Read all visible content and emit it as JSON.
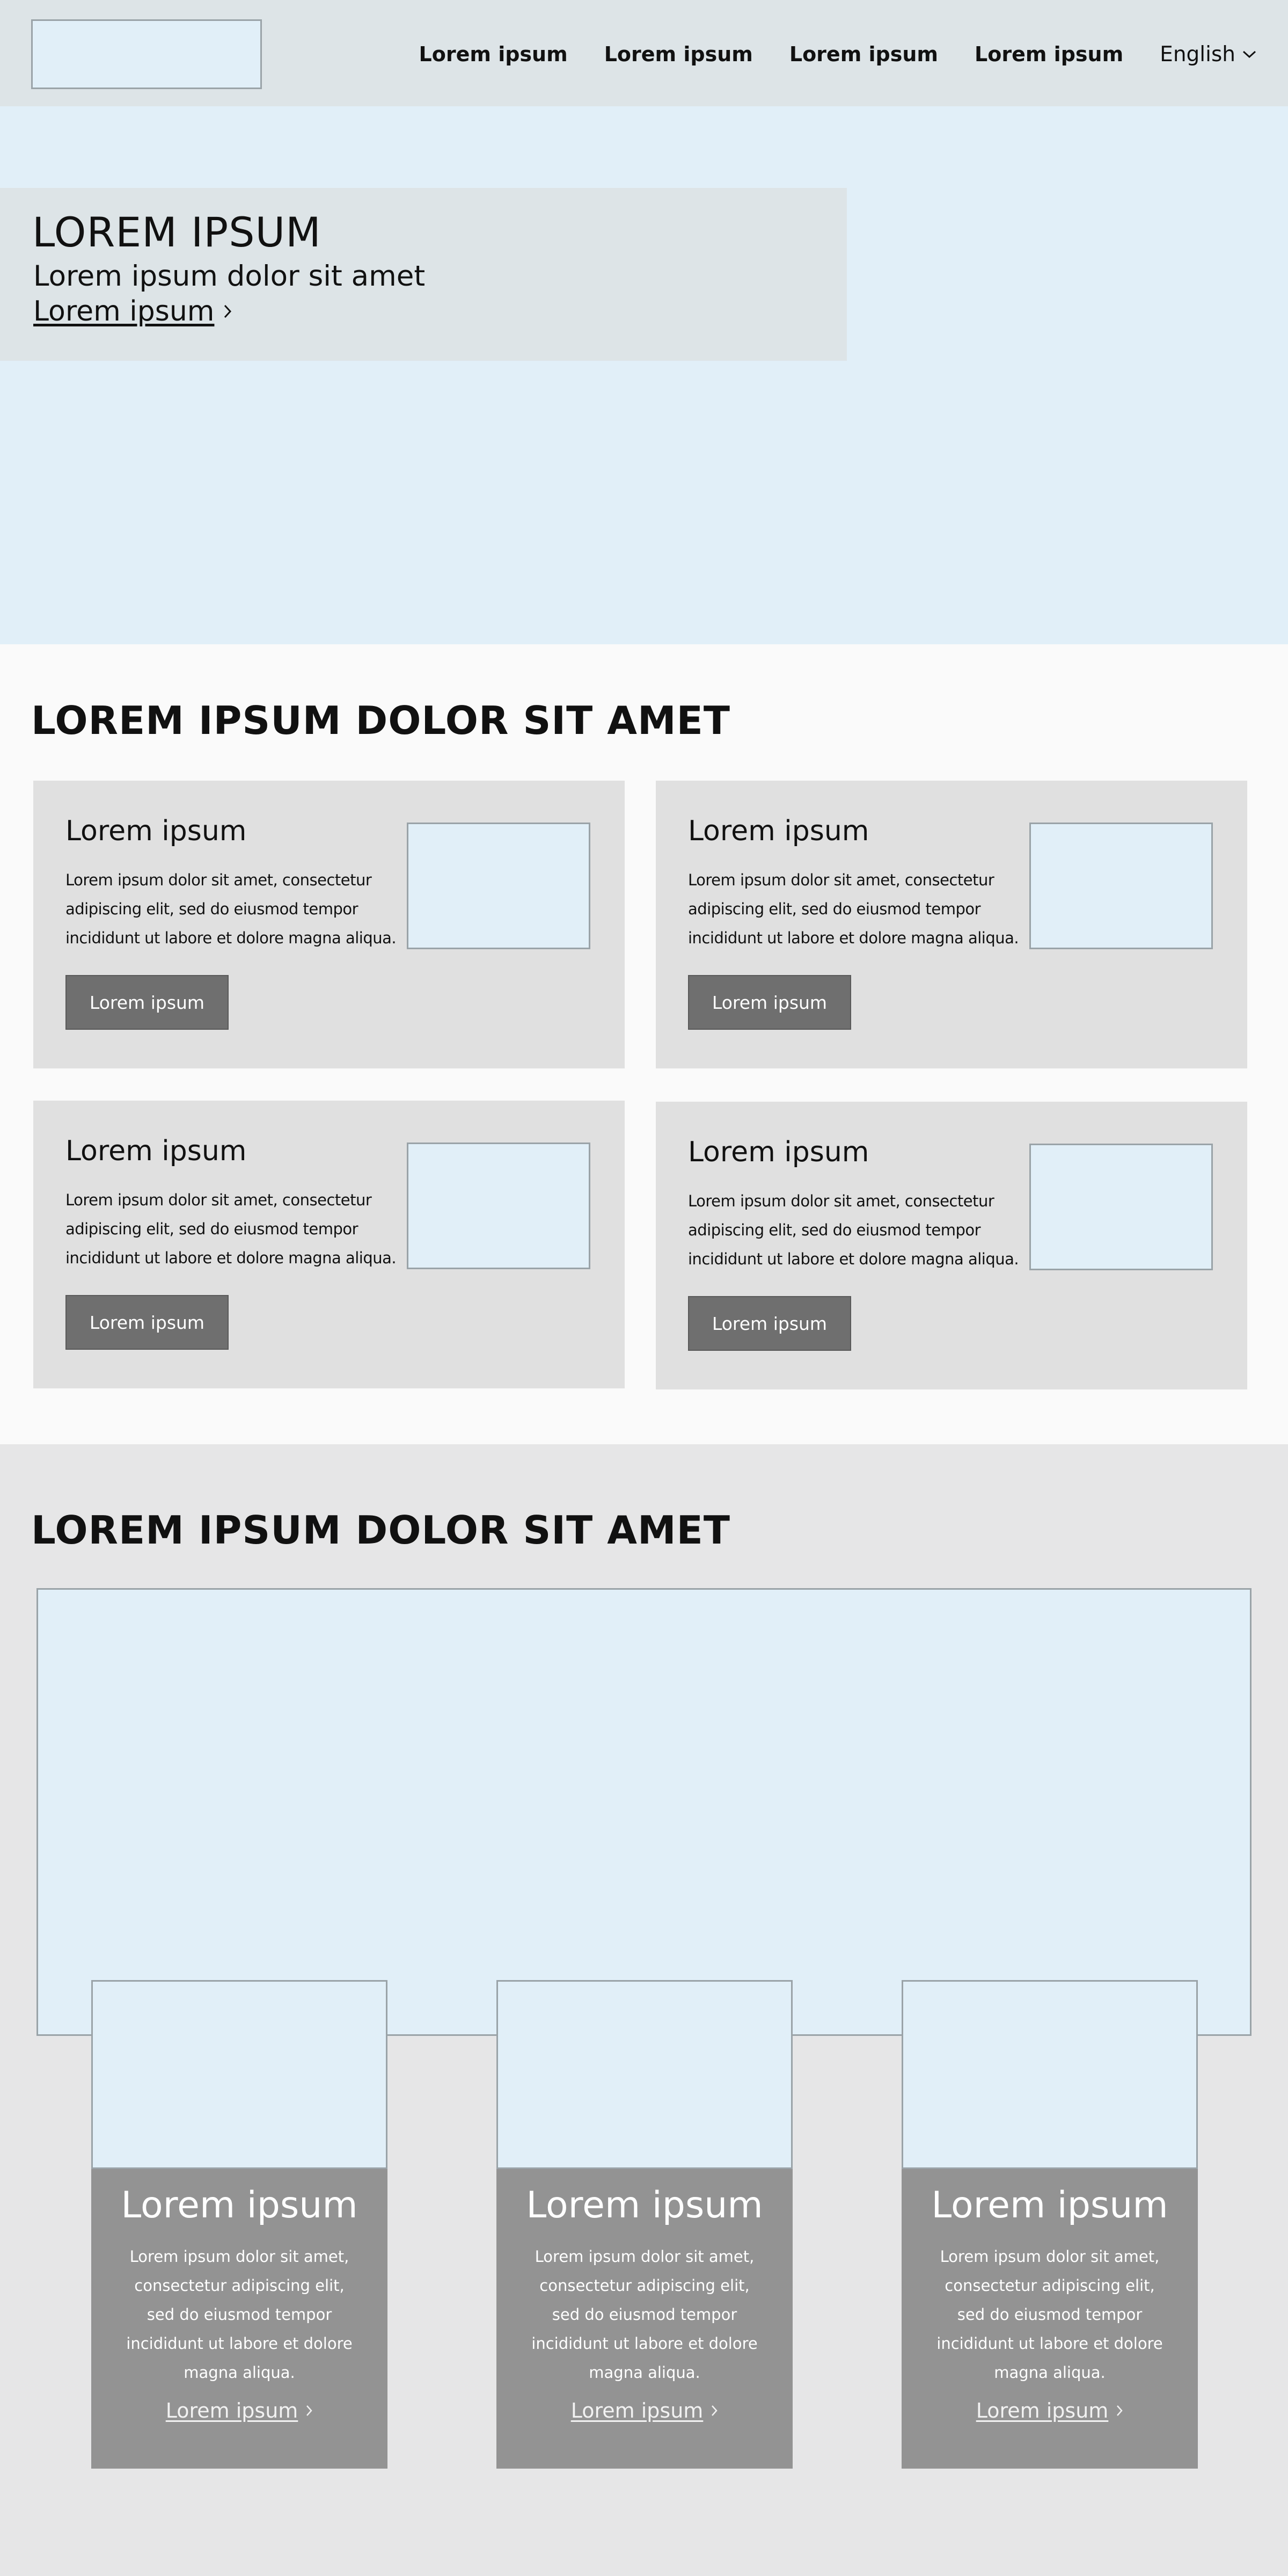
{
  "header": {
    "nav": [
      "Lorem ipsum",
      "Lorem ipsum",
      "Lorem ipsum",
      "Lorem ipsum"
    ],
    "language": "English",
    "language_icon": "chevron-down-icon"
  },
  "hero": {
    "title": "LOREM IPSUM",
    "subtitle": "Lorem ipsum dolor sit amet",
    "link": "Lorem ipsum",
    "link_icon": "chevron-right-icon"
  },
  "section1": {
    "title": "LOREM IPSUM DOLOR SIT AMET",
    "cards": [
      {
        "title": "Lorem ipsum",
        "text": "Lorem ipsum dolor sit amet, consectetur adipiscing elit, sed do eiusmod tempor incididunt ut labore et dolore magna aliqua.",
        "button": "Lorem ipsum"
      },
      {
        "title": "Lorem ipsum",
        "text": "Lorem ipsum dolor sit amet, consectetur adipiscing elit, sed do eiusmod tempor incididunt ut labore et dolore magna aliqua.",
        "button": "Lorem ipsum"
      },
      {
        "title": "Lorem ipsum",
        "text": "Lorem ipsum dolor sit amet, consectetur adipiscing elit, sed do eiusmod tempor incididunt ut labore et dolore magna aliqua.",
        "button": "Lorem ipsum"
      },
      {
        "title": "Lorem ipsum",
        "text": "Lorem ipsum dolor sit amet, consectetur adipiscing elit, sed do eiusmod tempor incididunt ut labore et dolore magna aliqua.",
        "button": "Lorem ipsum"
      }
    ]
  },
  "section2": {
    "title": "LOREM IPSUM DOLOR SIT AMET",
    "features": [
      {
        "title": "Lorem ipsum",
        "text": "Lorem ipsum dolor sit amet, consectetur adipiscing elit, sed do eiusmod tempor incididunt ut labore et dolore magna aliqua.",
        "link": "Lorem ipsum"
      },
      {
        "title": "Lorem ipsum",
        "text": "Lorem ipsum dolor sit amet, consectetur adipiscing elit, sed do eiusmod tempor incididunt ut labore et dolore magna aliqua.",
        "link": "Lorem ipsum"
      },
      {
        "title": "Lorem ipsum",
        "text": "Lorem ipsum dolor sit amet, consectetur adipiscing elit, sed do eiusmod tempor incididunt ut labore et dolore magna aliqua.",
        "link": "Lorem ipsum"
      }
    ]
  },
  "colors": {
    "header_bg": "#dde4e7",
    "placeholder_bg": "#e1eff8",
    "card_bg": "#e0e0e0",
    "button_bg": "#6f6f6f",
    "feature_bg": "#939393"
  }
}
